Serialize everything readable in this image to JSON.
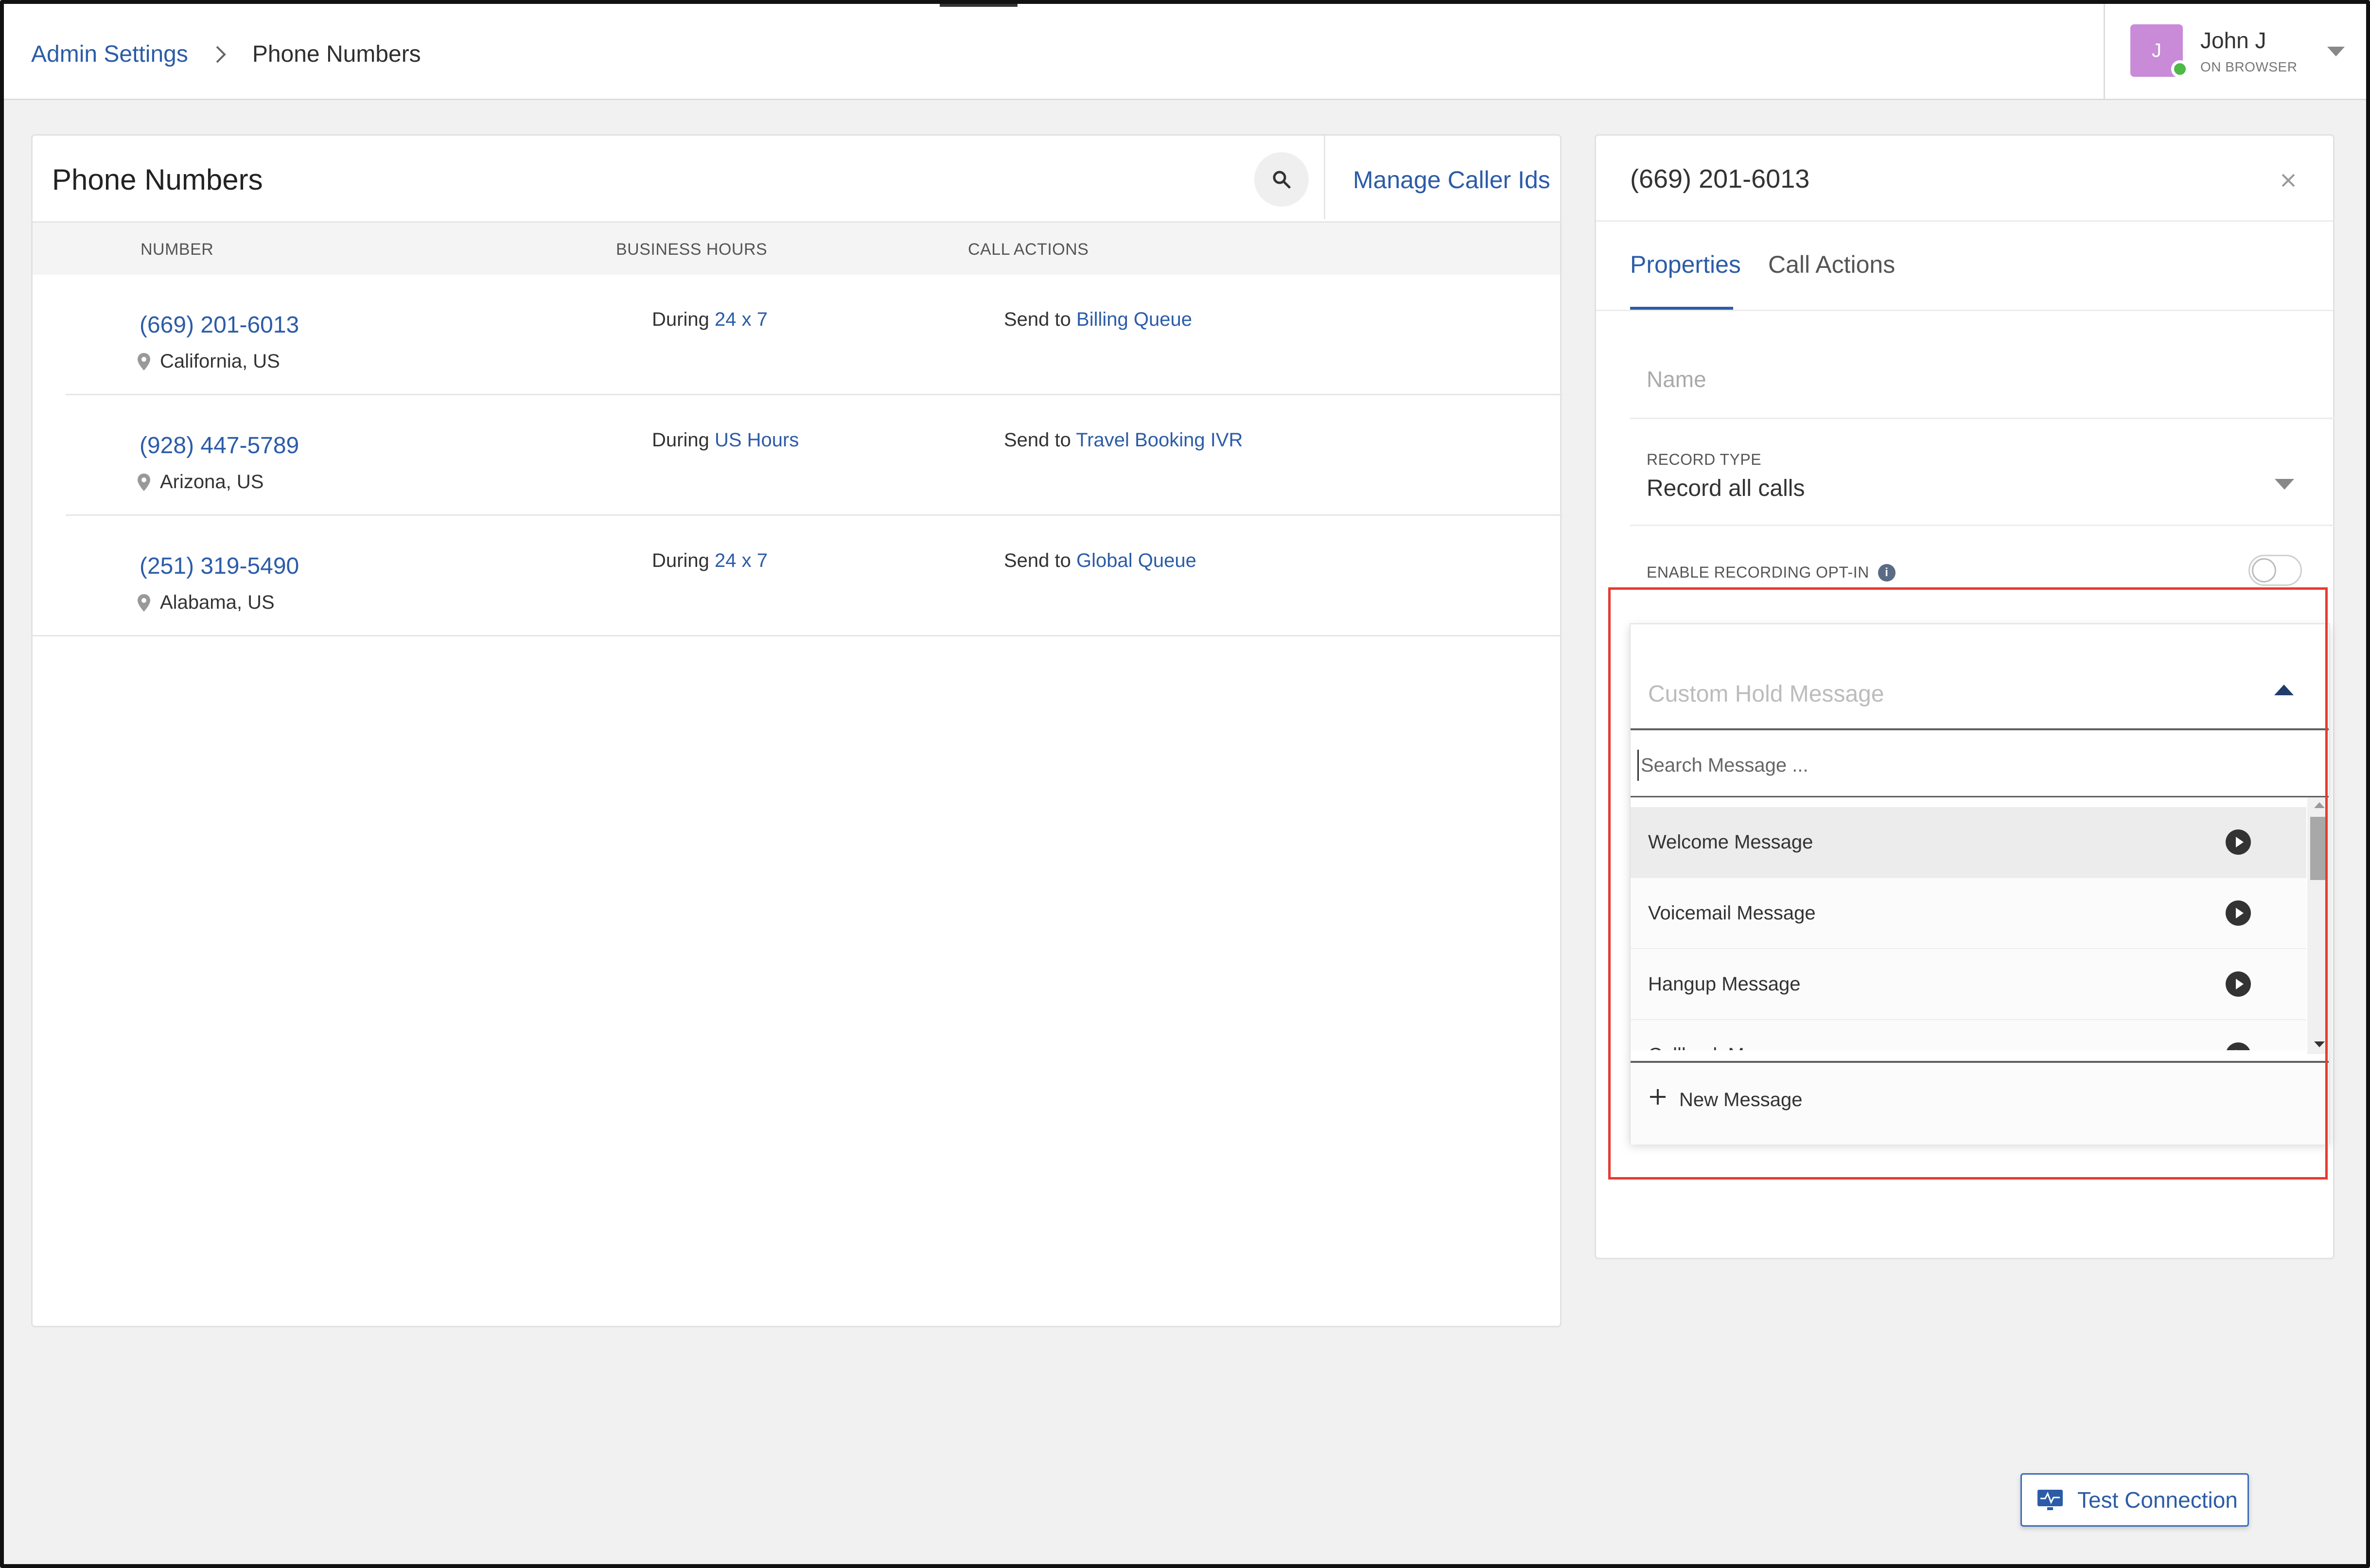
{
  "breadcrumb": {
    "parent": "Admin Settings",
    "current": "Phone Numbers"
  },
  "user": {
    "initial": "J",
    "name": "John J",
    "status": "ON BROWSER"
  },
  "phone_numbers": {
    "title": "Phone Numbers",
    "manage_link": "Manage Caller Ids",
    "columns": {
      "number": "NUMBER",
      "business_hours": "BUSINESS HOURS",
      "call_actions": "CALL ACTIONS"
    },
    "rows": [
      {
        "number": "(669) 201-6013",
        "location": "California, US",
        "hours_prefix": "During",
        "hours": "24 x 7",
        "action_prefix": "Send to",
        "action": "Billing Queue"
      },
      {
        "number": "(928) 447-5789",
        "location": "Arizona, US",
        "hours_prefix": "During",
        "hours": "US Hours",
        "action_prefix": "Send to",
        "action": "Travel Booking IVR"
      },
      {
        "number": "(251) 319-5490",
        "location": "Alabama, US",
        "hours_prefix": "During",
        "hours": "24 x 7",
        "action_prefix": "Send to",
        "action": "Global Queue"
      }
    ]
  },
  "details": {
    "title": "(669) 201-6013",
    "tabs": [
      "Properties",
      "Call Actions"
    ],
    "name_placeholder": "Name",
    "record_type_label": "RECORD TYPE",
    "record_type_value": "Record all calls",
    "opt_in_label": "ENABLE RECORDING OPT-IN",
    "opt_in_enabled": false
  },
  "hold_message_dropdown": {
    "title": "Custom Hold Message",
    "search_placeholder": "Search Message ...",
    "items": [
      "Welcome Message",
      "Voicemail Message",
      "Hangup Message",
      "Callback Message"
    ],
    "new_label": "New Message"
  },
  "test_connection": {
    "label": "Test Connection"
  },
  "colors": {
    "accent": "#2c5ca8",
    "highlight_border": "#e53b31",
    "status_online": "#4fb848",
    "avatar": "#c98ad8"
  }
}
